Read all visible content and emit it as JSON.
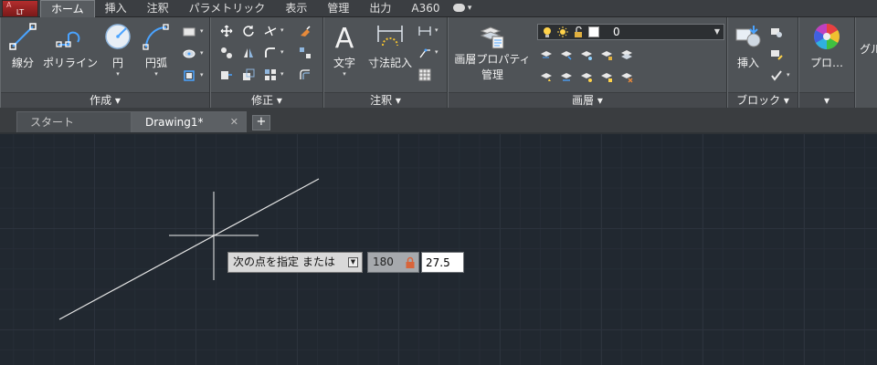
{
  "app_button": {
    "label": "LT",
    "mark": "A"
  },
  "menu_tabs": [
    "ホーム",
    "挿入",
    "注釈",
    "パラメトリック",
    "表示",
    "管理",
    "出力",
    "A360"
  ],
  "active_tab": "ホーム",
  "ribbon": {
    "draw": {
      "title": "作成",
      "buttons": {
        "line": "線分",
        "polyline": "ポリライン",
        "circle": "円",
        "arc": "円弧"
      }
    },
    "modify": {
      "title": "修正"
    },
    "annotation": {
      "title": "注釈",
      "buttons": {
        "text": "文字",
        "dimension": "寸法記入"
      }
    },
    "layers": {
      "title": "画層",
      "properties_button_line1": "画層プロパティ",
      "properties_button_line2": "管理",
      "current_layer": "0"
    },
    "block": {
      "title": "ブロック",
      "insert": "挿入"
    },
    "properties": {
      "label": "プロ…"
    },
    "groups": {
      "label": "グル"
    }
  },
  "file_tabs": [
    {
      "label": "スタート",
      "active": false
    },
    {
      "label": "Drawing1*",
      "active": true
    }
  ],
  "dynamic_input": {
    "prompt": "次の点を指定 または",
    "angle": "180",
    "length": "27.5"
  },
  "colors": {
    "canvas_bg": "#212830",
    "ribbon_bg": "#4f5357",
    "menubar_bg": "#3b3e42",
    "accent_blue": "#3f8fe0"
  }
}
